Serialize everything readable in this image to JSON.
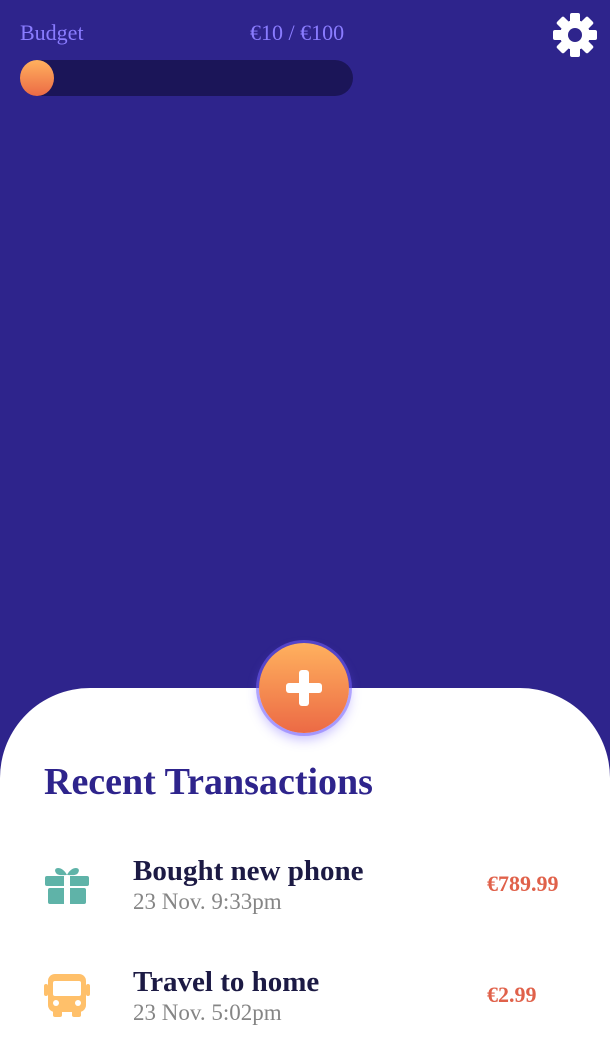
{
  "budget": {
    "label": "Budget",
    "amount_text": "€10 / €100",
    "spent_fraction": 0.1
  },
  "header": {
    "settings_icon": "gear-icon"
  },
  "fab": {
    "icon": "plus-icon"
  },
  "recent": {
    "title": "Recent Transactions",
    "items": [
      {
        "icon": "gift-icon",
        "title": "Bought new phone",
        "time": "23 Nov. 9:33pm",
        "amount": "€789.99"
      },
      {
        "icon": "bus-icon",
        "title": "Travel to home",
        "time": "23 Nov. 5:02pm",
        "amount": "€2.99"
      }
    ]
  },
  "colors": {
    "background": "#2e248c",
    "accent": "#8a7cff",
    "orange": "#ec6a45",
    "gift": "#5fb3a8",
    "bus": "#ffc06a",
    "amount": "#e0614a"
  }
}
